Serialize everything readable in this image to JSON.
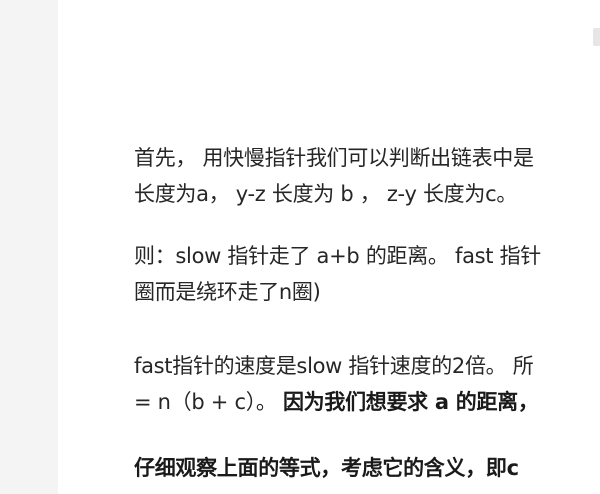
{
  "article": {
    "p1": {
      "line1": "首先， 用快慢指针我们可以判断出链表中是",
      "line2": "长度为a， y-z 长度为 b ， z-y 长度为c。"
    },
    "p2": {
      "line1": "则：slow 指针走了 a+b 的距离。 fast 指针",
      "line2": "圈而是绕环走了n圈)"
    },
    "p3": {
      "line1": "fast指针的速度是slow 指针速度的2倍。 所",
      "line2_normal": "= n（b + c）。 ",
      "line2_bold": "因为我们想要求 a 的距离，"
    },
    "p4": {
      "line1_bold": "仔细观察上面的等式，考虑它的含义，即c"
    }
  }
}
